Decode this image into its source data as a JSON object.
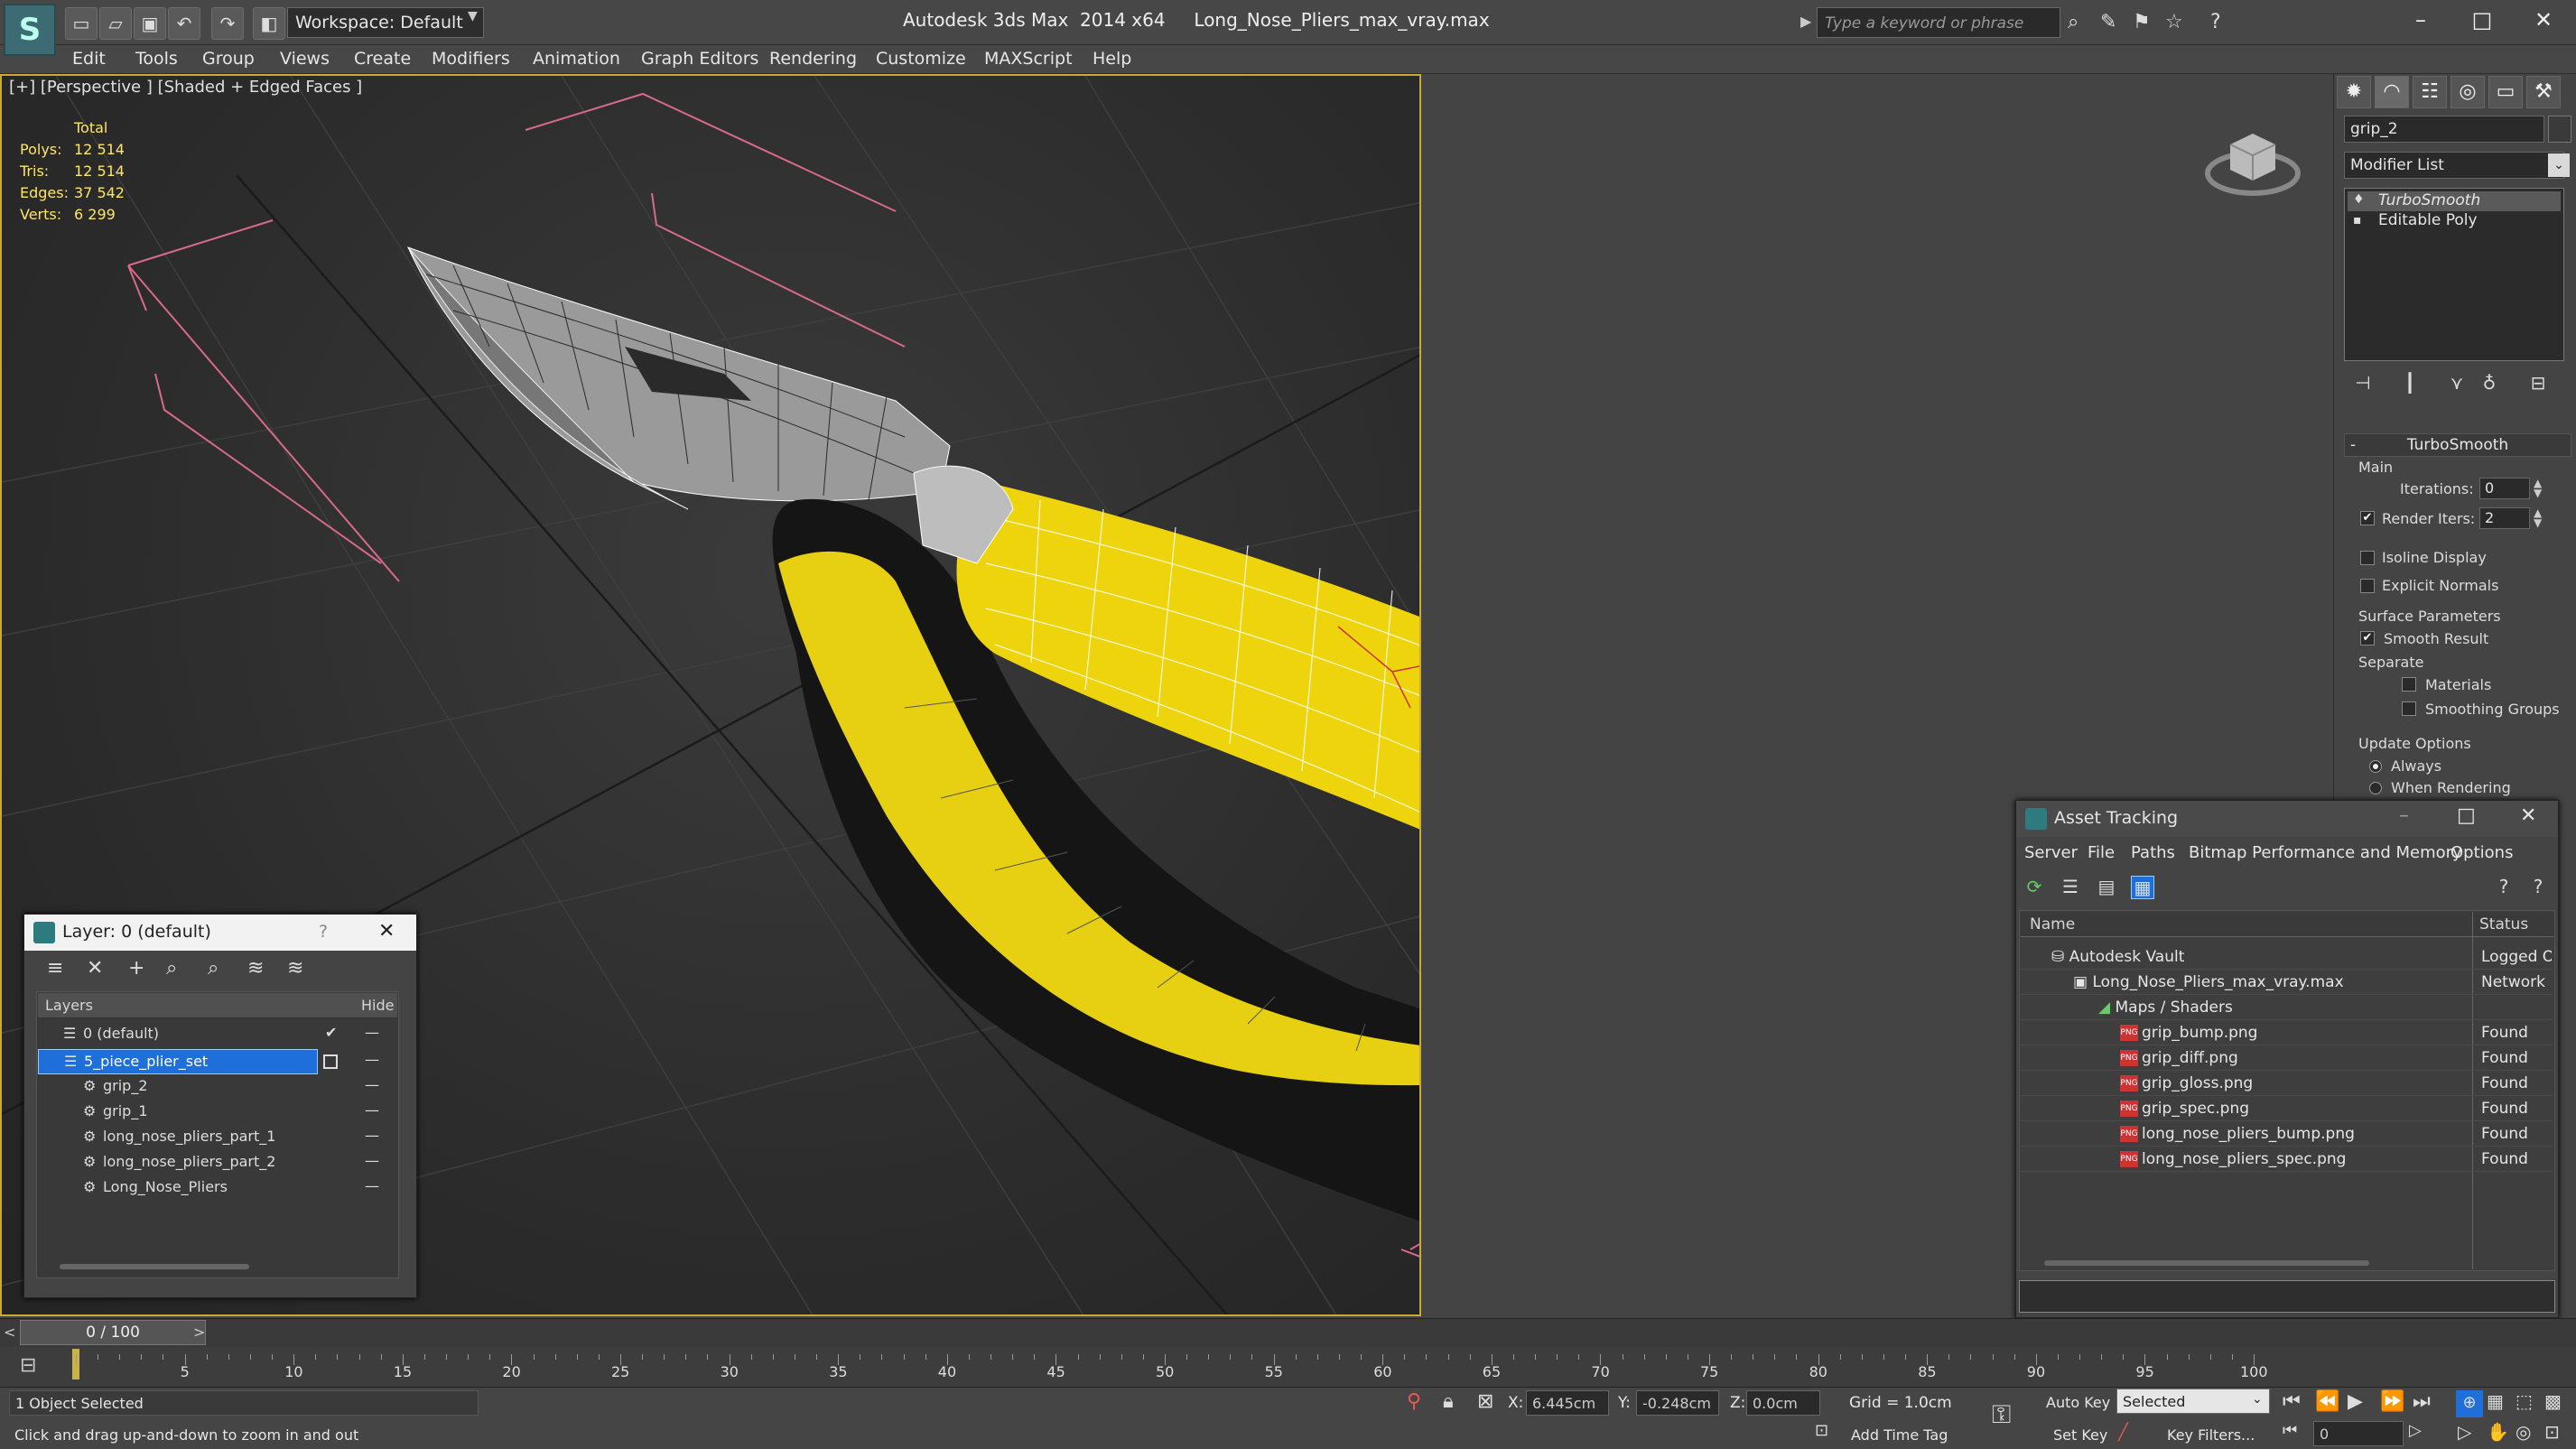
{
  "titlebar": {
    "workspace": "Workspace: Default",
    "app_title": "Autodesk 3ds Max  2014 x64",
    "file_title": "Long_Nose_Pliers_max_vray.max",
    "search_placeholder": "Type a keyword or phrase"
  },
  "menu": [
    "Edit",
    "Tools",
    "Group",
    "Views",
    "Create",
    "Modifiers",
    "Animation",
    "Graph Editors",
    "Rendering",
    "Customize",
    "MAXScript",
    "Help"
  ],
  "viewport": {
    "label": "[+] [Perspective ] [Shaded + Edged Faces ]",
    "stats_header": "Total",
    "stats": [
      {
        "k": "Polys:",
        "v": "12 514"
      },
      {
        "k": "Tris:",
        "v": "12 514"
      },
      {
        "k": "Edges:",
        "v": "37 542"
      },
      {
        "k": "Verts:",
        "v": "6 299"
      }
    ]
  },
  "colors": {
    "accent_yellow": "#f2d80a",
    "handle_black": "#151515",
    "selection_blue": "#1e6fd9",
    "viewport_border": "#c9a93a"
  },
  "command_panel": {
    "object_name": "grip_2",
    "modifier_list": "Modifier List",
    "stack": [
      "TurboSmooth",
      "Editable Poly"
    ],
    "rollout_title": "TurboSmooth",
    "main_label": "Main",
    "iterations_label": "Iterations:",
    "iterations_value": "0",
    "render_iters_label": "Render Iters:",
    "render_iters_value": "2",
    "isoline_label": "Isoline Display",
    "explicit_normals_label": "Explicit Normals",
    "surface_params_label": "Surface Parameters",
    "smooth_result_label": "Smooth Result",
    "separate_label": "Separate",
    "materials_label": "Materials",
    "smoothing_groups_label": "Smoothing Groups",
    "update_options_label": "Update Options",
    "always_label": "Always",
    "when_rendering_label": "When Rendering"
  },
  "layer_window": {
    "title": "Layer: 0 (default)",
    "help": "?",
    "col_layers": "Layers",
    "col_hide": "Hide",
    "rows": [
      {
        "name": "0 (default)",
        "indent": 0
      },
      {
        "name": "5_piece_plier_set",
        "indent": 0
      },
      {
        "name": "grip_2",
        "indent": 1
      },
      {
        "name": "grip_1",
        "indent": 1
      },
      {
        "name": "long_nose_pliers_part_1",
        "indent": 1
      },
      {
        "name": "long_nose_pliers_part_2",
        "indent": 1
      },
      {
        "name": "Long_Nose_Pliers",
        "indent": 1
      }
    ]
  },
  "asset_window": {
    "title": "Asset Tracking",
    "menu": [
      "Server",
      "File",
      "Paths",
      "Bitmap Performance and Memory",
      "Options"
    ],
    "col_name": "Name",
    "col_status": "Status",
    "rows": [
      {
        "name": "Autodesk Vault",
        "status": "Logged Out",
        "indent": 1
      },
      {
        "name": "Long_Nose_Pliers_max_vray.max",
        "status": "Network P",
        "indent": 2
      },
      {
        "name": "Maps / Shaders",
        "status": "",
        "indent": 3
      },
      {
        "name": "grip_bump.png",
        "status": "Found",
        "indent": 4
      },
      {
        "name": "grip_diff.png",
        "status": "Found",
        "indent": 4
      },
      {
        "name": "grip_gloss.png",
        "status": "Found",
        "indent": 4
      },
      {
        "name": "grip_spec.png",
        "status": "Found",
        "indent": 4
      },
      {
        "name": "long_nose_pliers_bump.png",
        "status": "Found",
        "indent": 4
      },
      {
        "name": "long_nose_pliers_spec.png",
        "status": "Found",
        "indent": 4
      }
    ]
  },
  "timeline": {
    "slider": "0 / 100",
    "ticks": [
      "5",
      "10",
      "15",
      "20",
      "25",
      "30",
      "35",
      "40",
      "45",
      "50",
      "55",
      "60",
      "65",
      "70",
      "75",
      "80",
      "85",
      "90",
      "95",
      "100"
    ]
  },
  "status": {
    "selected": "1 Object Selected",
    "prompt": "Click and drag up-and-down to zoom in and out",
    "x_label": "X:",
    "x_value": "6.445cm",
    "y_label": "Y:",
    "y_value": "-0.248cm",
    "z_label": "Z:",
    "z_value": "0.0cm",
    "grid": "Grid = 1.0cm",
    "add_time_tag": "Add Time Tag",
    "auto_key": "Auto Key",
    "set_key": "Set Key",
    "key_mode": "Selected",
    "key_filters": "Key Filters...",
    "frame": "0"
  }
}
